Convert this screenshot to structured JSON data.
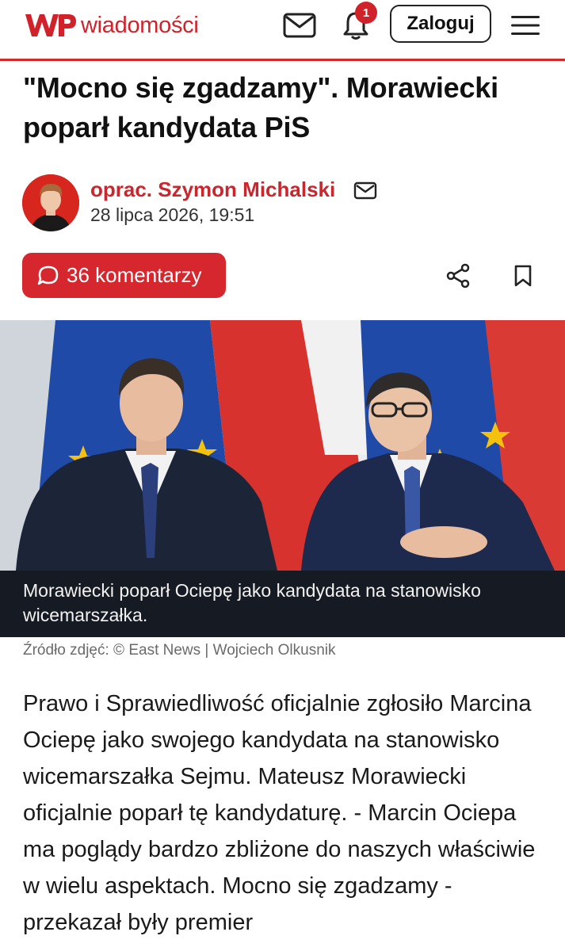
{
  "header": {
    "logo_text": "wiadomości",
    "notification_count": "1",
    "login_label": "Zaloguj",
    "icons": [
      "mail-icon",
      "bell-icon",
      "hamburger-menu-icon"
    ],
    "brand_color": "#d0222a"
  },
  "article": {
    "headline": "\"Mocno się zgadzamy\". Morawiecki poparł kandydata PiS",
    "author": "oprac. Szymon Michalski",
    "date": "28 lipca 2026, 19:51",
    "comments_label": "36 komentarzy",
    "photo_caption": "Morawiecki poparł Ociepę jako kandydata na stanowisko wicemarszałka.",
    "photo_source": "Źródło zdjęć: © East News | Wojciech Olkusnik",
    "lead": "Prawo i Sprawiedliwość oficjalnie zgłosiło Marcina Ociepę jako swojego kandydata na stanowisko wicemarszałka Sejmu. Mateusz Morawiecki oficjalnie poparł tę kandydaturę. - Marcin Ociepa ma poglądy bardzo zbliżone do naszych właściwie w wielu aspektach. Mocno się zgadzamy - przekazał były premier"
  }
}
